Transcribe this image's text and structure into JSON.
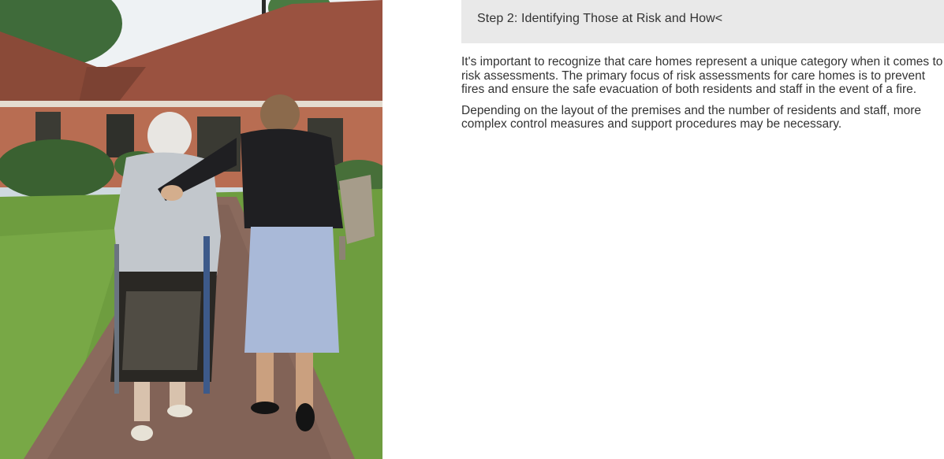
{
  "photo": {
    "alt_subject": "care-home-residents-walk"
  },
  "step": {
    "title": "Step 2: Identifying Those at Risk and How<",
    "paragraphs": [
      "It's important to recognize that care homes represent a unique category when it comes to risk assessments. The primary focus of risk assessments for care homes is to prevent fires and ensure the safe evacuation of both residents and staff in the event of a fire.",
      "Depending on the layout of the premises and the number of residents and staff, more complex control measures and support procedures may be necessary."
    ]
  },
  "colors": {
    "header_bg": "#e9e9e9",
    "text": "#333333",
    "page_bg": "#ffffff"
  }
}
